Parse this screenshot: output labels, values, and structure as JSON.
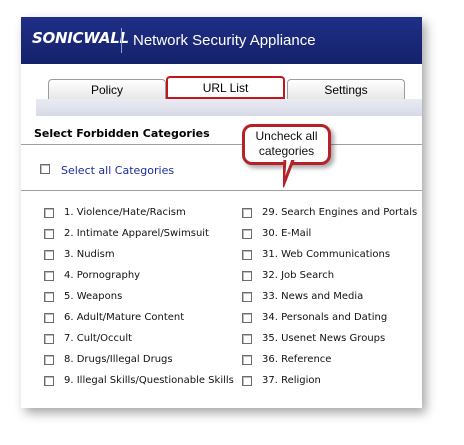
{
  "header": {
    "brand": "SONICWALL",
    "title": "Network Security Appliance"
  },
  "tabs": [
    {
      "label": "Policy"
    },
    {
      "label": "URL List",
      "active": true
    },
    {
      "label": "Settings"
    }
  ],
  "section": {
    "title": "Select Forbidden Categories",
    "select_all_label": "Select all Categories"
  },
  "callout": {
    "line1": "Uncheck all",
    "line2": "categories"
  },
  "categories_left": [
    {
      "label": "1. Violence/Hate/Racism",
      "checked": false
    },
    {
      "label": "2. Intimate Apparel/Swimsuit",
      "checked": false
    },
    {
      "label": "3. Nudism",
      "checked": false
    },
    {
      "label": "4. Pornography",
      "checked": false
    },
    {
      "label": "5. Weapons",
      "checked": false
    },
    {
      "label": "6. Adult/Mature Content",
      "checked": false
    },
    {
      "label": "7. Cult/Occult",
      "checked": false
    },
    {
      "label": "8. Drugs/Illegal Drugs",
      "checked": false
    },
    {
      "label": "9. Illegal Skills/Questionable Skills",
      "checked": false
    }
  ],
  "categories_right": [
    {
      "label": "29. Search Engines and Portals",
      "checked": false
    },
    {
      "label": "30. E-Mail",
      "checked": false
    },
    {
      "label": "31. Web Communications",
      "checked": false
    },
    {
      "label": "32. Job Search",
      "checked": false
    },
    {
      "label": "33. News and Media",
      "checked": false
    },
    {
      "label": "34. Personals and Dating",
      "checked": false
    },
    {
      "label": "35. Usenet News Groups",
      "checked": false
    },
    {
      "label": "36. Reference",
      "checked": false
    },
    {
      "label": "37. Religion",
      "checked": false
    }
  ],
  "colors": {
    "header_bg": "#1a2a7a",
    "accent_red": "#c2161f",
    "link_blue": "#1c2ba0"
  }
}
